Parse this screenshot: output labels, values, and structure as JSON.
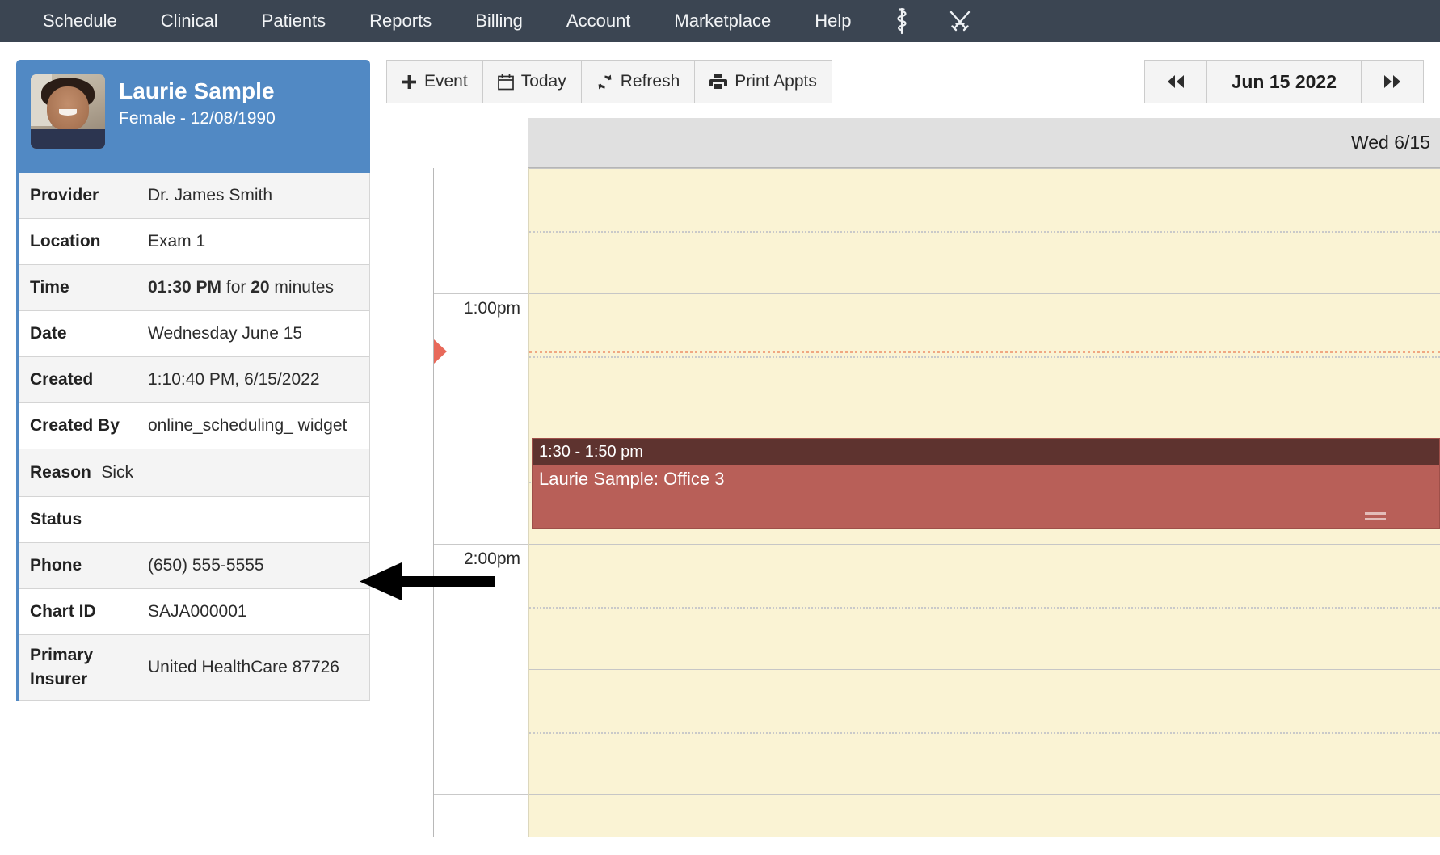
{
  "nav": {
    "items": [
      {
        "label": "Schedule"
      },
      {
        "label": "Clinical"
      },
      {
        "label": "Patients"
      },
      {
        "label": "Reports"
      },
      {
        "label": "Billing"
      },
      {
        "label": "Account"
      },
      {
        "label": "Marketplace"
      },
      {
        "label": "Help"
      }
    ],
    "icons": [
      {
        "name": "rod-of-asclepius-icon"
      },
      {
        "name": "crossed-swords-icon"
      }
    ],
    "background": "#3b4552"
  },
  "patient": {
    "name": "Laurie Sample",
    "subtitle": "Female - 12/08/1990",
    "header_color": "#5189c4",
    "avatar_alt": "patient-photo"
  },
  "appointment_info": [
    {
      "label": "Provider",
      "value": "Dr. James Smith"
    },
    {
      "label": "Location",
      "value": "Exam 1"
    },
    {
      "label": "Time",
      "value": "01:30 PM for 20 minutes",
      "value_bold_1": "01:30 PM",
      "value_mid": " for ",
      "value_bold_2": "20",
      "value_tail": " minutes"
    },
    {
      "label": "Date",
      "value": "Wednesday June 15"
    },
    {
      "label": "Created",
      "value": "1:10:40 PM, 6/15/2022"
    },
    {
      "label": "Created By",
      "value": "online_scheduling_ widget"
    },
    {
      "label": "Reason",
      "value": "Sick"
    },
    {
      "label": "Status",
      "value": ""
    },
    {
      "label": "Phone",
      "value": "(650) 555-5555"
    },
    {
      "label": "Chart ID",
      "value": "SAJA000001"
    },
    {
      "label": "Primary Insurer",
      "value": "United HealthCare 87726"
    }
  ],
  "toolbar": {
    "event_label": "Event",
    "today_label": "Today",
    "refresh_label": "Refresh",
    "print_label": "Print Appts"
  },
  "date_nav": {
    "prev_label": "◀◀",
    "current_date": "Jun 15 2022",
    "next_label": "▶▶"
  },
  "calendar": {
    "day_header": "Wed 6/15",
    "time_labels": [
      "1:00pm",
      "2:00pm"
    ],
    "background": "#faf3d4",
    "now_indicator_color": "#e8695a",
    "appointment": {
      "time_range": "1:30 - 1:50 pm",
      "title": "Laurie Sample: Office 3",
      "header_color": "#5e332f",
      "body_color": "#b85f58"
    }
  }
}
